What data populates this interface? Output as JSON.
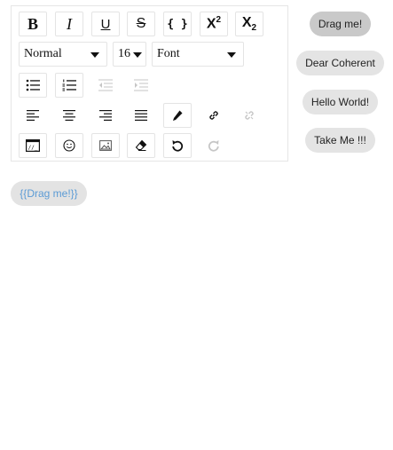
{
  "toolbar": {
    "bold": "B",
    "italic": "I",
    "underline": "U",
    "strike": "S",
    "code": "{ }",
    "superscript_base": "X",
    "superscript_exp": "2",
    "subscript_base": "X",
    "subscript_exp": "2",
    "block_format": "Normal",
    "font_size": "16",
    "font_family": "Font"
  },
  "pills": {
    "drag_me": "Drag me!",
    "dear_coherent": "Dear Coherent",
    "hello_world": "Hello World!",
    "take_me": "Take Me !!!",
    "template": "{{Drag me!}}"
  },
  "colors": {
    "accent_template_text": "#5b9bd5",
    "pill_bg": "#e4e4e4",
    "pill_active_bg": "#c9c9c9"
  }
}
